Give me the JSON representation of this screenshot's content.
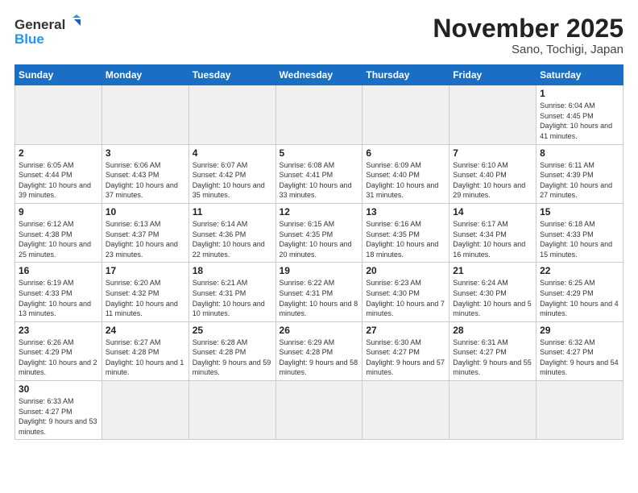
{
  "logo": {
    "text_general": "General",
    "text_blue": "Blue"
  },
  "title": "November 2025",
  "subtitle": "Sano, Tochigi, Japan",
  "days_of_week": [
    "Sunday",
    "Monday",
    "Tuesday",
    "Wednesday",
    "Thursday",
    "Friday",
    "Saturday"
  ],
  "weeks": [
    [
      {
        "day": "",
        "empty": true
      },
      {
        "day": "",
        "empty": true
      },
      {
        "day": "",
        "empty": true
      },
      {
        "day": "",
        "empty": true
      },
      {
        "day": "",
        "empty": true
      },
      {
        "day": "",
        "empty": true
      },
      {
        "day": "1",
        "sunrise": "6:04 AM",
        "sunset": "4:45 PM",
        "daylight": "10 hours and 41 minutes."
      }
    ],
    [
      {
        "day": "2",
        "sunrise": "6:05 AM",
        "sunset": "4:44 PM",
        "daylight": "10 hours and 39 minutes."
      },
      {
        "day": "3",
        "sunrise": "6:06 AM",
        "sunset": "4:43 PM",
        "daylight": "10 hours and 37 minutes."
      },
      {
        "day": "4",
        "sunrise": "6:07 AM",
        "sunset": "4:42 PM",
        "daylight": "10 hours and 35 minutes."
      },
      {
        "day": "5",
        "sunrise": "6:08 AM",
        "sunset": "4:41 PM",
        "daylight": "10 hours and 33 minutes."
      },
      {
        "day": "6",
        "sunrise": "6:09 AM",
        "sunset": "4:40 PM",
        "daylight": "10 hours and 31 minutes."
      },
      {
        "day": "7",
        "sunrise": "6:10 AM",
        "sunset": "4:40 PM",
        "daylight": "10 hours and 29 minutes."
      },
      {
        "day": "8",
        "sunrise": "6:11 AM",
        "sunset": "4:39 PM",
        "daylight": "10 hours and 27 minutes."
      }
    ],
    [
      {
        "day": "9",
        "sunrise": "6:12 AM",
        "sunset": "4:38 PM",
        "daylight": "10 hours and 25 minutes."
      },
      {
        "day": "10",
        "sunrise": "6:13 AM",
        "sunset": "4:37 PM",
        "daylight": "10 hours and 23 minutes."
      },
      {
        "day": "11",
        "sunrise": "6:14 AM",
        "sunset": "4:36 PM",
        "daylight": "10 hours and 22 minutes."
      },
      {
        "day": "12",
        "sunrise": "6:15 AM",
        "sunset": "4:35 PM",
        "daylight": "10 hours and 20 minutes."
      },
      {
        "day": "13",
        "sunrise": "6:16 AM",
        "sunset": "4:35 PM",
        "daylight": "10 hours and 18 minutes."
      },
      {
        "day": "14",
        "sunrise": "6:17 AM",
        "sunset": "4:34 PM",
        "daylight": "10 hours and 16 minutes."
      },
      {
        "day": "15",
        "sunrise": "6:18 AM",
        "sunset": "4:33 PM",
        "daylight": "10 hours and 15 minutes."
      }
    ],
    [
      {
        "day": "16",
        "sunrise": "6:19 AM",
        "sunset": "4:33 PM",
        "daylight": "10 hours and 13 minutes."
      },
      {
        "day": "17",
        "sunrise": "6:20 AM",
        "sunset": "4:32 PM",
        "daylight": "10 hours and 11 minutes."
      },
      {
        "day": "18",
        "sunrise": "6:21 AM",
        "sunset": "4:31 PM",
        "daylight": "10 hours and 10 minutes."
      },
      {
        "day": "19",
        "sunrise": "6:22 AM",
        "sunset": "4:31 PM",
        "daylight": "10 hours and 8 minutes."
      },
      {
        "day": "20",
        "sunrise": "6:23 AM",
        "sunset": "4:30 PM",
        "daylight": "10 hours and 7 minutes."
      },
      {
        "day": "21",
        "sunrise": "6:24 AM",
        "sunset": "4:30 PM",
        "daylight": "10 hours and 5 minutes."
      },
      {
        "day": "22",
        "sunrise": "6:25 AM",
        "sunset": "4:29 PM",
        "daylight": "10 hours and 4 minutes."
      }
    ],
    [
      {
        "day": "23",
        "sunrise": "6:26 AM",
        "sunset": "4:29 PM",
        "daylight": "10 hours and 2 minutes."
      },
      {
        "day": "24",
        "sunrise": "6:27 AM",
        "sunset": "4:28 PM",
        "daylight": "10 hours and 1 minute."
      },
      {
        "day": "25",
        "sunrise": "6:28 AM",
        "sunset": "4:28 PM",
        "daylight": "9 hours and 59 minutes."
      },
      {
        "day": "26",
        "sunrise": "6:29 AM",
        "sunset": "4:28 PM",
        "daylight": "9 hours and 58 minutes."
      },
      {
        "day": "27",
        "sunrise": "6:30 AM",
        "sunset": "4:27 PM",
        "daylight": "9 hours and 57 minutes."
      },
      {
        "day": "28",
        "sunrise": "6:31 AM",
        "sunset": "4:27 PM",
        "daylight": "9 hours and 55 minutes."
      },
      {
        "day": "29",
        "sunrise": "6:32 AM",
        "sunset": "4:27 PM",
        "daylight": "9 hours and 54 minutes."
      }
    ],
    [
      {
        "day": "30",
        "sunrise": "6:33 AM",
        "sunset": "4:27 PM",
        "daylight": "9 hours and 53 minutes."
      },
      {
        "day": "",
        "empty": true
      },
      {
        "day": "",
        "empty": true
      },
      {
        "day": "",
        "empty": true
      },
      {
        "day": "",
        "empty": true
      },
      {
        "day": "",
        "empty": true
      },
      {
        "day": "",
        "empty": true
      }
    ]
  ]
}
